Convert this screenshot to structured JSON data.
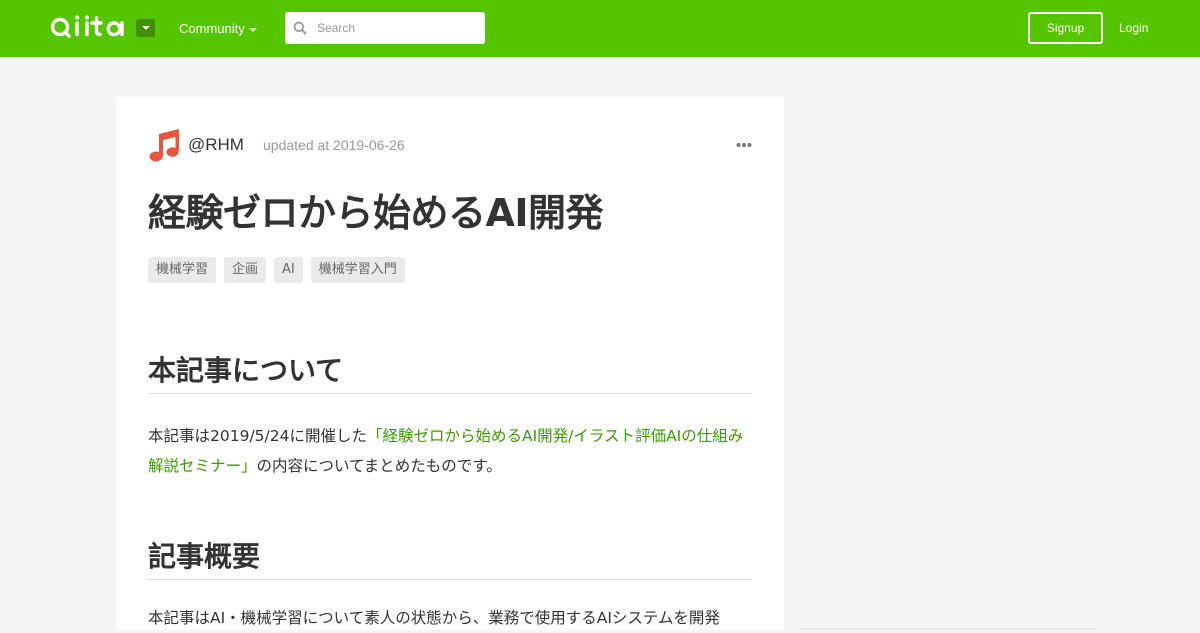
{
  "header": {
    "logo_text": "Qiita",
    "community_label": "Community",
    "search_placeholder": "Search",
    "signup_label": "Signup",
    "login_label": "Login",
    "bg_color": "#55c500"
  },
  "article": {
    "author": "@RHM",
    "updated": "updated at 2019-06-26",
    "title": "経験ゼロから始めるAI開発",
    "tags": [
      "機械学習",
      "企画",
      "AI",
      "機械学習入門"
    ],
    "sections": [
      {
        "heading": "本記事について",
        "text_before": "本記事は2019/5/24に開催した",
        "link_text": "「経験ゼロから始めるAI開発/イラスト評価AIの仕組み解説セミナー」",
        "text_after": "の内容についてまとめたものです。"
      },
      {
        "heading": "記事概要",
        "text": "本記事はAI・機械学習について素人の状態から、業務で使用するAIシステムを開発"
      }
    ],
    "avatar_icon": "music-note-icon",
    "link_color": "#3a9d00"
  }
}
